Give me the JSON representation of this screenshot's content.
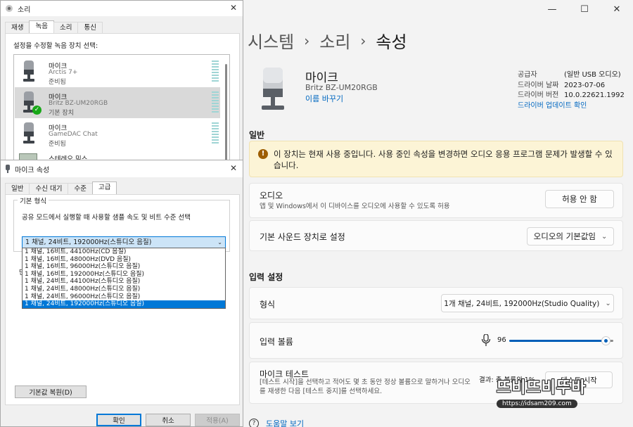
{
  "settings": {
    "window_controls": [
      "—",
      "☐",
      "✕"
    ],
    "breadcrumb": [
      "시스템",
      "소리",
      "속성"
    ],
    "device": {
      "name": "마이크",
      "model": "Britz BZ-UM20RGB",
      "rename": "이름 바꾸기"
    },
    "info": [
      {
        "key": "공급자",
        "value": "(일반 USB 오디오)"
      },
      {
        "key": "드라이버 날짜",
        "value": "2023-07-06"
      },
      {
        "key": "드라이버 버전",
        "value": "10.0.22621.1992"
      }
    ],
    "driver_update": "드라이버 업데이트 확인",
    "general_heading": "일반",
    "warning": "이 장치는 현재 사용 중입니다. 사용 중인 속성을 변경하면 오디오 응용 프로그램 문제가 발생할 수 있습니다.",
    "audio": {
      "title": "오디오",
      "desc": "앱 및 Windows에서 이 디바이스를 오디오에 사용할 수 있도록 허용",
      "button": "허용 안 함"
    },
    "default_device": {
      "title": "기본 사운드 장치로 설정",
      "value": "오디오의 기본값임"
    },
    "input_heading": "입력 설정",
    "format": {
      "title": "형식",
      "value": "1개 채널, 24비트, 192000Hz(Studio Quality)"
    },
    "volume": {
      "title": "입력 볼륨",
      "value": "96",
      "level": 0.96
    },
    "mic_test": {
      "title": "마이크 테스트",
      "desc": "[테스트 시작]을 선택하고 적어도 몇 초 동안 정상 볼륨으로 말하거나 오디오를 재생한 다음 [테스트 중지]를 선택하세요.",
      "result": "결과: 총 볼륨의 1%",
      "button": "테스트 시작"
    },
    "help": "도움말 보기",
    "watermark": {
      "title": "뜨비뜨비뚜바",
      "url": "https://idsam209.com"
    }
  },
  "sound_window": {
    "title": "소리",
    "tabs": [
      "재생",
      "녹음",
      "소리",
      "통신"
    ],
    "active_tab": 1,
    "instruction": "설정을 수정할 녹음 장치 선택:",
    "devices": [
      {
        "name": "마이크",
        "model": "Arctis 7+",
        "status": "준비됨"
      },
      {
        "name": "마이크",
        "model": "Britz BZ-UM20RGB",
        "status": "기본 장치"
      },
      {
        "name": "마이크",
        "model": "GameDAC Chat",
        "status": "준비됨"
      },
      {
        "name": "스테레오 믹스",
        "model": "",
        "status": ""
      }
    ]
  },
  "props": {
    "title": "마이크 속성",
    "tabs": [
      "일반",
      "수신 대기",
      "수준",
      "고급"
    ],
    "active_tab": 3,
    "group_label": "기본 형식",
    "group_desc": "공유 모드에서 실행할 때 사용할 샘플 속도 및 비트 수준 선택",
    "selected": "1 채널, 24비트, 192000Hz(스튜디오 음질)",
    "options": [
      "1 채널, 16비트, 44100Hz(CD 음질)",
      "1 채널, 16비트, 48000Hz(DVD 음질)",
      "1 채널, 16비트, 96000Hz(스튜디오 음질)",
      "1 채널, 16비트, 192000Hz(스튜디오 음질)",
      "1 채널, 24비트, 44100Hz(스튜디오 음질)",
      "1 채널, 24비트, 48000Hz(스튜디오 음질)",
      "1 채널, 24비트, 96000Hz(스튜디오 음질)",
      "1 채널, 24비트, 192000Hz(스튜디오 음질)"
    ],
    "restore": "기본값 복원(D)",
    "ok": "확인",
    "cancel": "취소",
    "apply": "적용(A)"
  }
}
